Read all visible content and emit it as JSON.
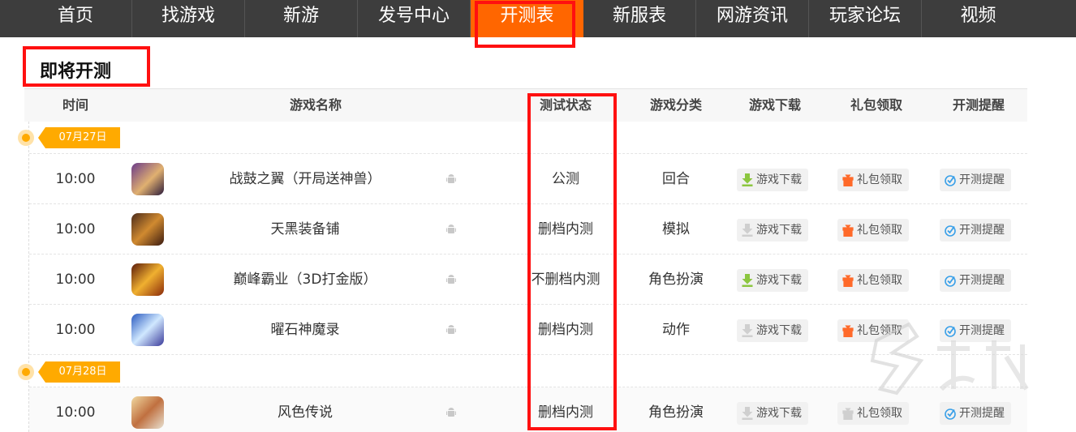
{
  "nav": {
    "items": [
      "首页",
      "找游戏",
      "新游",
      "发号中心",
      "开测表",
      "新服表",
      "网游资讯",
      "玩家论坛",
      "视频"
    ],
    "active_index": 4
  },
  "section": {
    "title": "即将开测"
  },
  "table": {
    "headers": {
      "time": "时间",
      "name": "游戏名称",
      "status": "测试状态",
      "category": "游戏分类",
      "download": "游戏下载",
      "gift": "礼包领取",
      "remind": "开测提醒"
    }
  },
  "dates": [
    "07月27日",
    "07月28日"
  ],
  "rows": [
    {
      "time": "10:00",
      "name": "战鼓之翼（开局送神兽）",
      "status": "公测",
      "category": "回合",
      "download": "游戏下载",
      "download_enabled": true,
      "gift": "礼包领取",
      "gift_enabled": true,
      "remind": "开测提醒"
    },
    {
      "time": "10:00",
      "name": "天黑装备铺",
      "status": "删档内测",
      "category": "模拟",
      "download": "游戏下载",
      "download_enabled": false,
      "gift": "礼包领取",
      "gift_enabled": true,
      "remind": "开测提醒"
    },
    {
      "time": "10:00",
      "name": "巅峰霸业（3D打金版）",
      "status": "不删档内测",
      "category": "角色扮演",
      "download": "游戏下载",
      "download_enabled": true,
      "gift": "礼包领取",
      "gift_enabled": true,
      "remind": "开测提醒"
    },
    {
      "time": "10:00",
      "name": "曜石神魔录",
      "status": "删档内测",
      "category": "动作",
      "download": "游戏下载",
      "download_enabled": false,
      "gift": "礼包领取",
      "gift_enabled": true,
      "remind": "开测提醒"
    },
    {
      "time": "10:00",
      "name": "风色传说",
      "status": "删档内测",
      "category": "角色扮演",
      "download": "游戏下载",
      "download_enabled": false,
      "gift": "礼包领取",
      "gift_enabled": false,
      "remind": "开测提醒"
    }
  ],
  "colors": {
    "nav_bg": "#3d3d3d",
    "nav_active": "#ff6600",
    "annotation_red": "#ff1010",
    "date_tag": "#ffaa00",
    "download_green": "#8cc63f",
    "gift_orange": "#ff6a2a",
    "remind_blue": "#3aa0e8"
  }
}
